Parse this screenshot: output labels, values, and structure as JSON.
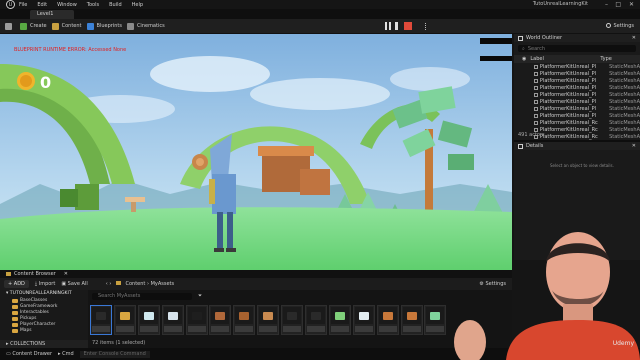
{
  "menu": {
    "items": [
      "File",
      "Edit",
      "Window",
      "Tools",
      "Build",
      "Help"
    ],
    "project_title": "TutoUnrealLearningKit",
    "window_controls": [
      "–",
      "□",
      "✕"
    ]
  },
  "level_tab": {
    "label": "Level1"
  },
  "toolbar": {
    "buttons": [
      {
        "label": "",
        "icon": "save-icon"
      },
      {
        "label": "Create",
        "icon": "create-icon"
      },
      {
        "label": "Content",
        "icon": "content-icon"
      },
      {
        "label": "Blueprints",
        "icon": "blueprint-icon"
      },
      {
        "label": "Cinematics",
        "icon": "cinematics-icon"
      }
    ],
    "settings_label": "Settings"
  },
  "viewport": {
    "error_text": "BLUEPRINT RUNTIME ERROR: Accessed None",
    "coin_count": "0"
  },
  "outliner": {
    "title": "World Outliner",
    "search_placeholder": "Search",
    "col_label": "Label",
    "col_type": "Type",
    "rows": [
      {
        "name": "PlatformerKitUnreal_Pl",
        "type": "StaticMeshA"
      },
      {
        "name": "PlatformerKitUnreal_Pl",
        "type": "StaticMeshA"
      },
      {
        "name": "PlatformerKitUnreal_Pl",
        "type": "StaticMeshA"
      },
      {
        "name": "PlatformerKitUnreal_Pl",
        "type": "StaticMeshA"
      },
      {
        "name": "PlatformerKitUnreal_Pl",
        "type": "StaticMeshA"
      },
      {
        "name": "PlatformerKitUnreal_Pl",
        "type": "StaticMeshA"
      },
      {
        "name": "PlatformerKitUnreal_Pl",
        "type": "StaticMeshA"
      },
      {
        "name": "PlatformerKitUnreal_Pl",
        "type": "StaticMeshA"
      },
      {
        "name": "PlatformerKitUnreal_Rc",
        "type": "StaticMeshA"
      },
      {
        "name": "PlatformerKitUnreal_Rc",
        "type": "StaticMeshA"
      },
      {
        "name": "PlatformerKitUnreal_Rc",
        "type": "StaticMeshA"
      },
      {
        "name": "PlatformerKitUnreal_Rc",
        "type": "StaticMeshA"
      },
      {
        "name": "PlatformerKitUnreal_Rc",
        "type": "StaticMeshA"
      }
    ],
    "actor_count": "491 actors"
  },
  "details": {
    "title": "Details",
    "hint": "Select an object to view details."
  },
  "content_browser": {
    "tab_label": "Content Browser",
    "add_label": "+ ADD",
    "import_label": "Import",
    "save_all_label": "Save All",
    "path": [
      "Content",
      "MyAssets"
    ],
    "settings_label": "Settings",
    "tree_root": "TUTOUNREALLEARNINGKIT",
    "folders": [
      "BaseClasses",
      "GameFramework",
      "Interactables",
      "Pickups",
      "PlayerCharacter",
      "Maps"
    ],
    "collections_label": "COLLECTIONS",
    "search_placeholder": "Search MyAssets",
    "items_count": "72 items (1 selected)"
  },
  "status": {
    "content_drawer": "Content Drawer",
    "cmd": "Cmd",
    "cmd_placeholder": "Enter Console Command"
  },
  "watermark": "Udemy"
}
